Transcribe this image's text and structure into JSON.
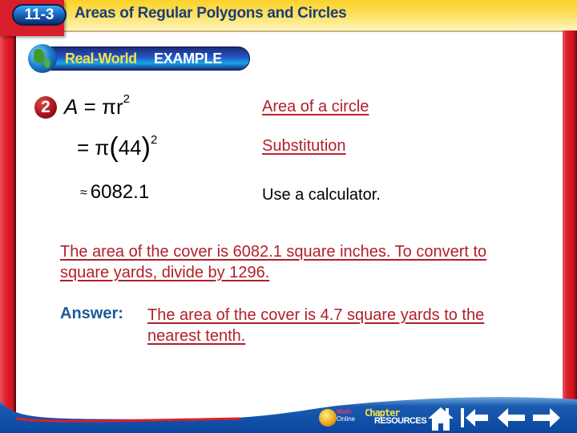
{
  "header": {
    "lesson_number": "11-3",
    "lesson_title": "Areas of Regular Polygons and Circles",
    "example_banner": {
      "highlight": "Real-World",
      "label": "EXAMPLE"
    }
  },
  "step": {
    "number": "2",
    "equations": [
      {
        "lhs": "A",
        "rel": "=",
        "expr": "πr",
        "exp": "2"
      },
      {
        "rel": "=",
        "expr_prefix": "π",
        "inner": "44",
        "exp": "2"
      },
      {
        "rel": "≈",
        "expr": "6082.1"
      }
    ],
    "notes": [
      {
        "text": "Area of a circle",
        "style": "link"
      },
      {
        "text": "Substitution",
        "style": "link"
      },
      {
        "text": "Use a calculator.",
        "style": "plain"
      }
    ]
  },
  "paragraph": "The area of the cover is 6082.1 square inches. To convert to square yards, divide by 1296.",
  "answer": {
    "label": "Answer:",
    "text": "The area of the cover is 4.7 square yards to the nearest tenth."
  },
  "nav": {
    "math_online": {
      "line1": "Math",
      "line2": "Online"
    },
    "chapter_resources": {
      "line1": "Chapter",
      "line2": "RESOURCES"
    },
    "buttons": [
      {
        "name": "home",
        "icon": "home-icon"
      },
      {
        "name": "first",
        "icon": "first-slide-icon"
      },
      {
        "name": "previous",
        "icon": "arrow-left-icon"
      },
      {
        "name": "next",
        "icon": "arrow-right-icon"
      }
    ]
  },
  "colors": {
    "header_yellow": "#fcd22a",
    "frame_red": "#e11d28",
    "title_blue": "#1b3d7a",
    "link_red": "#b0202a",
    "answer_blue": "#1d5a9a",
    "nav_blue": "#0a4aa0"
  }
}
